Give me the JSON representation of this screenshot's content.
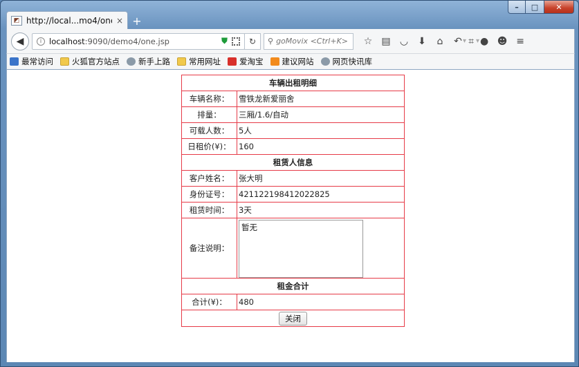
{
  "browser": {
    "tab_title": "http://local...mo4/one.jsp",
    "tab_close": "×",
    "new_tab": "+",
    "url_host": "localhost",
    "url_rest": ":9090/demo4/one.jsp",
    "search_placeholder": "goMovix <Ctrl+K>",
    "bookmarks": [
      {
        "label": "最常访问",
        "icon": "blue"
      },
      {
        "label": "火狐官方站点",
        "icon": "folder"
      },
      {
        "label": "新手上路",
        "icon": "globe"
      },
      {
        "label": "常用网址",
        "icon": "folder"
      },
      {
        "label": "爱淘宝",
        "icon": "red"
      },
      {
        "label": "建议网站",
        "icon": "orange"
      },
      {
        "label": "网页快讯库",
        "icon": "globe"
      }
    ]
  },
  "page": {
    "section_vehicle": "车辆出租明细",
    "vehicle_name_label": "车辆名称：",
    "vehicle_name_value": "雪铁龙新爱丽舍",
    "displacement_label": "排量：",
    "displacement_value": "三厢/1.6/自动",
    "capacity_label": "可载人数：",
    "capacity_value": "5人",
    "daily_rent_label": "日租价(¥)：",
    "daily_rent_value": "160",
    "section_renter": "租赁人信息",
    "customer_name_label": "客户姓名：",
    "customer_name_value": "张大明",
    "id_number_label": "身份证号：",
    "id_number_value": "421122198412022825",
    "rent_time_label": "租赁时间：",
    "rent_time_value": "3天",
    "remark_label": "备注说明：",
    "remark_value": "暂无",
    "section_total": "租金合计",
    "total_label": "合计(¥)：",
    "total_value": "480",
    "close_button": "关闭"
  }
}
